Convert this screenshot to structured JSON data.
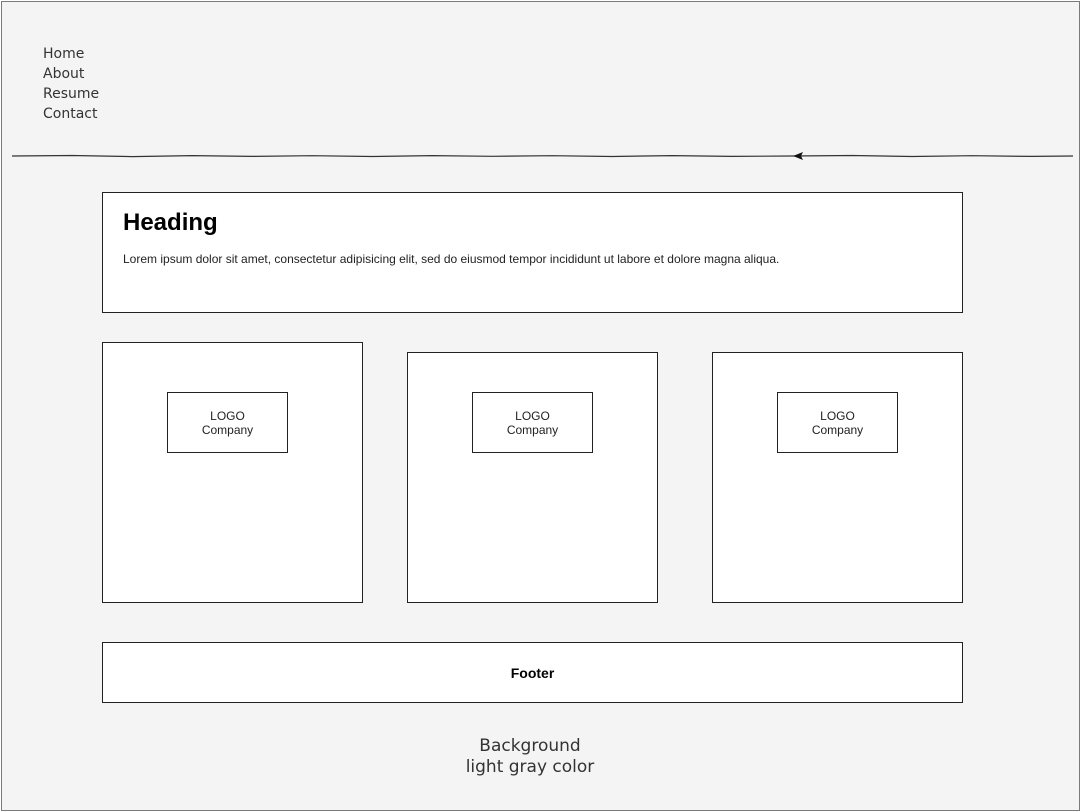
{
  "nav": {
    "items": [
      "Home",
      "About",
      "Resume",
      "Contact"
    ]
  },
  "hero": {
    "heading": "Heading",
    "text": "Lorem ipsum dolor sit amet, consectetur adipisicing elit, sed do eiusmod tempor incididunt ut labore et dolore magna aliqua."
  },
  "cards": [
    {
      "logo": "LOGO",
      "company": "Company"
    },
    {
      "logo": "LOGO",
      "company": "Company"
    },
    {
      "logo": "LOGO",
      "company": "Company"
    }
  ],
  "footer": {
    "label": "Footer"
  },
  "annotation": {
    "line1": "Background",
    "line2": "light gray color"
  },
  "colors": {
    "background": "#f4f4f4",
    "box": "#ffffff",
    "stroke": "#222222"
  }
}
